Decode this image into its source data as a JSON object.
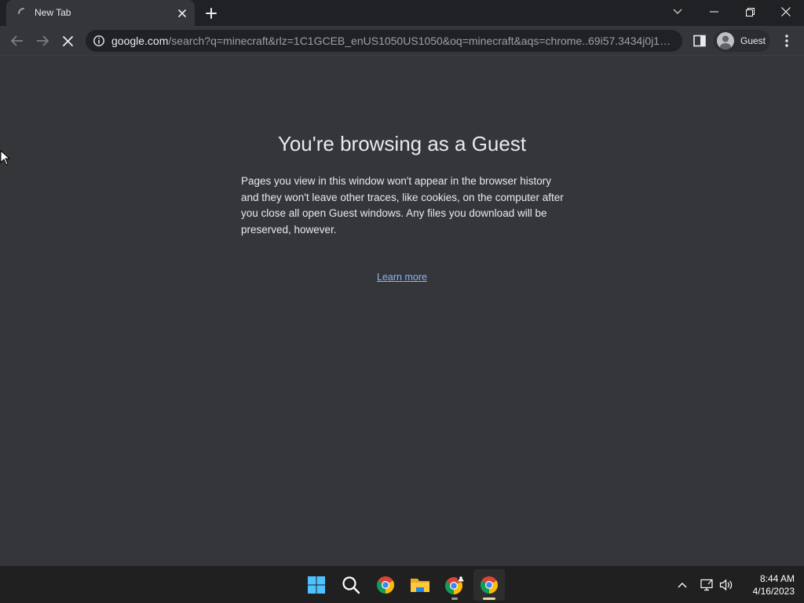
{
  "tab": {
    "title": "New Tab",
    "loading": true
  },
  "toolbar": {
    "url_domain": "google.com",
    "url_path": "/search?q=minecraft&rlz=1C1GCEB_enUS1050US1050&oq=minecraft&aqs=chrome..69i57.3434j0j1&...",
    "profile_label": "Guest"
  },
  "content": {
    "heading": "You're browsing as a Guest",
    "description": "Pages you view in this window won't appear in the browser history and they won't leave other traces, like cookies, on the computer after you close all open Guest windows. Any files you download will be preserved, however.",
    "learn_more": "Learn more",
    "link_color": "#8ab4f8"
  },
  "taskbar": {
    "apps": [
      "start-icon",
      "search-icon",
      "chrome-icon",
      "file-explorer-icon",
      "chrome-icon",
      "chrome-icon"
    ],
    "time": "8:44 AM",
    "date": "4/16/2023"
  },
  "colors": {
    "background": "#35363a",
    "tabstrip": "#202124",
    "text": "#e8eaed",
    "taskbar": "#202020"
  }
}
